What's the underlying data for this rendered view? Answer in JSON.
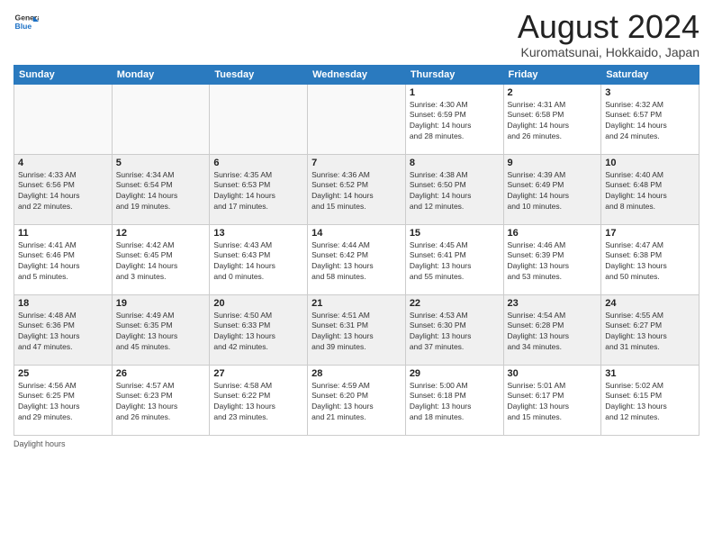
{
  "header": {
    "logo": {
      "general": "General",
      "blue": "Blue"
    },
    "title": "August 2024",
    "subtitle": "Kuromatsunai, Hokkaido, Japan"
  },
  "weekdays": [
    "Sunday",
    "Monday",
    "Tuesday",
    "Wednesday",
    "Thursday",
    "Friday",
    "Saturday"
  ],
  "weeks": [
    [
      {
        "day": "",
        "detail": ""
      },
      {
        "day": "",
        "detail": ""
      },
      {
        "day": "",
        "detail": ""
      },
      {
        "day": "",
        "detail": ""
      },
      {
        "day": "1",
        "detail": "Sunrise: 4:30 AM\nSunset: 6:59 PM\nDaylight: 14 hours\nand 28 minutes."
      },
      {
        "day": "2",
        "detail": "Sunrise: 4:31 AM\nSunset: 6:58 PM\nDaylight: 14 hours\nand 26 minutes."
      },
      {
        "day": "3",
        "detail": "Sunrise: 4:32 AM\nSunset: 6:57 PM\nDaylight: 14 hours\nand 24 minutes."
      }
    ],
    [
      {
        "day": "4",
        "detail": "Sunrise: 4:33 AM\nSunset: 6:56 PM\nDaylight: 14 hours\nand 22 minutes."
      },
      {
        "day": "5",
        "detail": "Sunrise: 4:34 AM\nSunset: 6:54 PM\nDaylight: 14 hours\nand 19 minutes."
      },
      {
        "day": "6",
        "detail": "Sunrise: 4:35 AM\nSunset: 6:53 PM\nDaylight: 14 hours\nand 17 minutes."
      },
      {
        "day": "7",
        "detail": "Sunrise: 4:36 AM\nSunset: 6:52 PM\nDaylight: 14 hours\nand 15 minutes."
      },
      {
        "day": "8",
        "detail": "Sunrise: 4:38 AM\nSunset: 6:50 PM\nDaylight: 14 hours\nand 12 minutes."
      },
      {
        "day": "9",
        "detail": "Sunrise: 4:39 AM\nSunset: 6:49 PM\nDaylight: 14 hours\nand 10 minutes."
      },
      {
        "day": "10",
        "detail": "Sunrise: 4:40 AM\nSunset: 6:48 PM\nDaylight: 14 hours\nand 8 minutes."
      }
    ],
    [
      {
        "day": "11",
        "detail": "Sunrise: 4:41 AM\nSunset: 6:46 PM\nDaylight: 14 hours\nand 5 minutes."
      },
      {
        "day": "12",
        "detail": "Sunrise: 4:42 AM\nSunset: 6:45 PM\nDaylight: 14 hours\nand 3 minutes."
      },
      {
        "day": "13",
        "detail": "Sunrise: 4:43 AM\nSunset: 6:43 PM\nDaylight: 14 hours\nand 0 minutes."
      },
      {
        "day": "14",
        "detail": "Sunrise: 4:44 AM\nSunset: 6:42 PM\nDaylight: 13 hours\nand 58 minutes."
      },
      {
        "day": "15",
        "detail": "Sunrise: 4:45 AM\nSunset: 6:41 PM\nDaylight: 13 hours\nand 55 minutes."
      },
      {
        "day": "16",
        "detail": "Sunrise: 4:46 AM\nSunset: 6:39 PM\nDaylight: 13 hours\nand 53 minutes."
      },
      {
        "day": "17",
        "detail": "Sunrise: 4:47 AM\nSunset: 6:38 PM\nDaylight: 13 hours\nand 50 minutes."
      }
    ],
    [
      {
        "day": "18",
        "detail": "Sunrise: 4:48 AM\nSunset: 6:36 PM\nDaylight: 13 hours\nand 47 minutes."
      },
      {
        "day": "19",
        "detail": "Sunrise: 4:49 AM\nSunset: 6:35 PM\nDaylight: 13 hours\nand 45 minutes."
      },
      {
        "day": "20",
        "detail": "Sunrise: 4:50 AM\nSunset: 6:33 PM\nDaylight: 13 hours\nand 42 minutes."
      },
      {
        "day": "21",
        "detail": "Sunrise: 4:51 AM\nSunset: 6:31 PM\nDaylight: 13 hours\nand 39 minutes."
      },
      {
        "day": "22",
        "detail": "Sunrise: 4:53 AM\nSunset: 6:30 PM\nDaylight: 13 hours\nand 37 minutes."
      },
      {
        "day": "23",
        "detail": "Sunrise: 4:54 AM\nSunset: 6:28 PM\nDaylight: 13 hours\nand 34 minutes."
      },
      {
        "day": "24",
        "detail": "Sunrise: 4:55 AM\nSunset: 6:27 PM\nDaylight: 13 hours\nand 31 minutes."
      }
    ],
    [
      {
        "day": "25",
        "detail": "Sunrise: 4:56 AM\nSunset: 6:25 PM\nDaylight: 13 hours\nand 29 minutes."
      },
      {
        "day": "26",
        "detail": "Sunrise: 4:57 AM\nSunset: 6:23 PM\nDaylight: 13 hours\nand 26 minutes."
      },
      {
        "day": "27",
        "detail": "Sunrise: 4:58 AM\nSunset: 6:22 PM\nDaylight: 13 hours\nand 23 minutes."
      },
      {
        "day": "28",
        "detail": "Sunrise: 4:59 AM\nSunset: 6:20 PM\nDaylight: 13 hours\nand 21 minutes."
      },
      {
        "day": "29",
        "detail": "Sunrise: 5:00 AM\nSunset: 6:18 PM\nDaylight: 13 hours\nand 18 minutes."
      },
      {
        "day": "30",
        "detail": "Sunrise: 5:01 AM\nSunset: 6:17 PM\nDaylight: 13 hours\nand 15 minutes."
      },
      {
        "day": "31",
        "detail": "Sunrise: 5:02 AM\nSunset: 6:15 PM\nDaylight: 13 hours\nand 12 minutes."
      }
    ]
  ],
  "footer": "Daylight hours"
}
